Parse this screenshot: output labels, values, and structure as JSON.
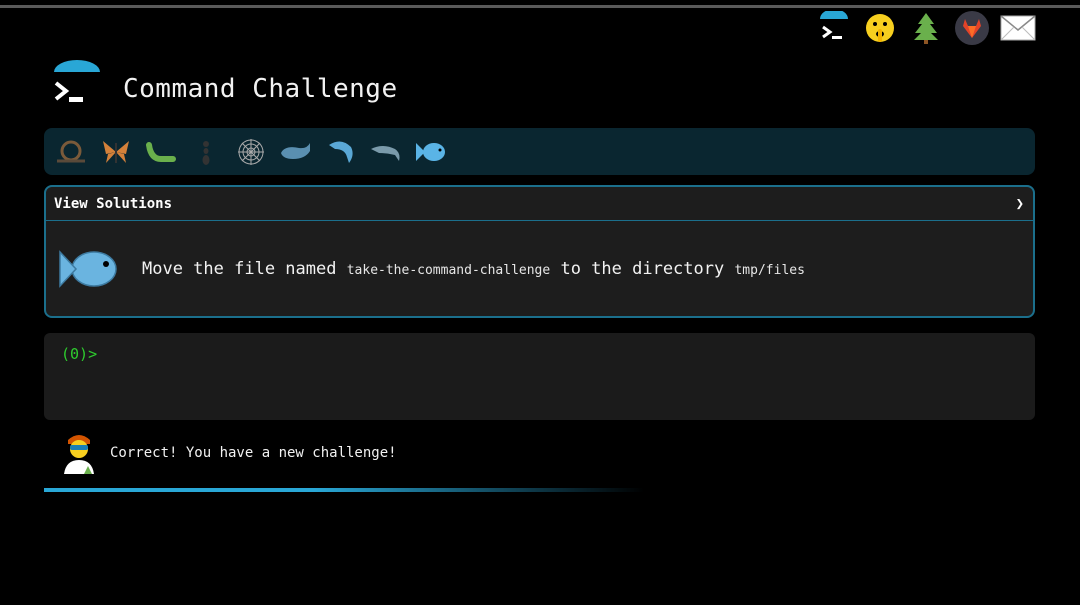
{
  "app": {
    "title": "Command Challenge"
  },
  "top_icons": [
    {
      "name": "terminal-logo-icon"
    },
    {
      "name": "shush-emoji-icon"
    },
    {
      "name": "tree-icon"
    },
    {
      "name": "gitlab-icon"
    },
    {
      "name": "mail-icon"
    }
  ],
  "animals": [
    {
      "name": "snail-icon"
    },
    {
      "name": "butterfly-icon"
    },
    {
      "name": "caterpillar-icon"
    },
    {
      "name": "ant-icon"
    },
    {
      "name": "spiderweb-icon"
    },
    {
      "name": "whale-icon"
    },
    {
      "name": "dolphin-jump-icon"
    },
    {
      "name": "dolphin-icon"
    },
    {
      "name": "fish-icon"
    }
  ],
  "challenge": {
    "view_solutions_label": "View Solutions",
    "chevron": "❯",
    "task_prefix": "Move the file named",
    "filename": "take-the-command-challenge",
    "task_middle": "to the directory",
    "directory": "tmp/files"
  },
  "terminal": {
    "prompt": "(0)>"
  },
  "feedback": {
    "message": "Correct! You have a new challenge!"
  },
  "colors": {
    "accent": "#29a7d6",
    "border": "#1b6f8c",
    "prompt": "#2ecc2e"
  }
}
